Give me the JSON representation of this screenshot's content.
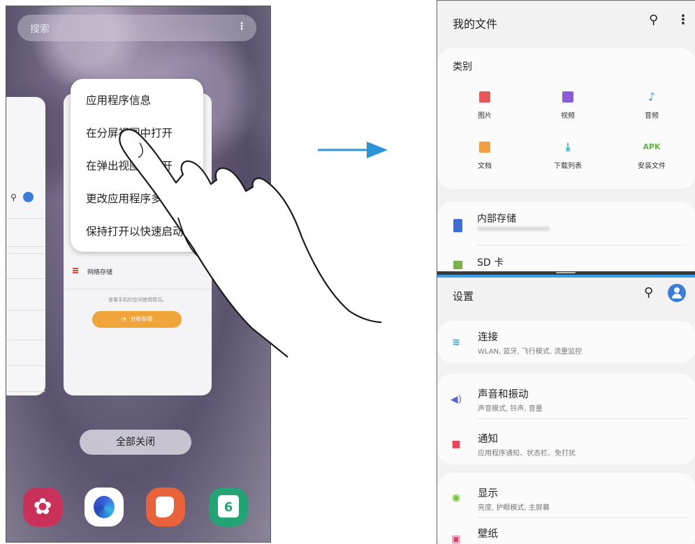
{
  "left_phone": {
    "search_placeholder": "搜索",
    "more_icon": "⋮",
    "context_menu": [
      "应用程序信息",
      "在分屏视图中打开",
      "在弹出视图中打开",
      "更改应用程序多",
      "保持打开以快速启动"
    ],
    "recent_card": {
      "network_storage": "网络存储",
      "hint": "查看手机的空间使用情况。",
      "analyze_button": "分析存储"
    },
    "close_all": "全部关闭",
    "dock_icons": [
      "gallery-icon",
      "bixby-icon",
      "samsung-notes-icon",
      "calendar-icon"
    ]
  },
  "right_phone": {
    "files": {
      "title": "我的文件",
      "category_title": "类别",
      "categories": [
        {
          "label": "图片",
          "icon": "image-icon",
          "color": "#e4575a"
        },
        {
          "label": "视频",
          "icon": "video-icon",
          "color": "#8a5cd6"
        },
        {
          "label": "音频",
          "icon": "audio-icon",
          "color": "#3d8ee0"
        },
        {
          "label": "文档",
          "icon": "document-icon",
          "color": "#f0a040"
        },
        {
          "label": "下载列表",
          "icon": "download-icon",
          "color": "#29a8c8"
        },
        {
          "label": "安装文件",
          "icon": "apk-icon",
          "color": "#62b347",
          "glyph": "APK"
        }
      ],
      "storage": [
        {
          "title": "内部存储"
        },
        {
          "title": "SD 卡"
        }
      ]
    },
    "settings": {
      "title": "设置",
      "rows": [
        {
          "title": "连接",
          "subtitle": "WLAN, 蓝牙, 飞行模式, 流量监控",
          "icon": "wifi-icon"
        },
        {
          "title": "声音和振动",
          "subtitle": "声音模式, 铃声, 音量",
          "icon": "sound-icon"
        },
        {
          "title": "通知",
          "subtitle": "应用程序通知、状态栏、免打扰",
          "icon": "notification-icon"
        },
        {
          "title": "显示",
          "subtitle": "亮度, 护眼模式, 主屏幕",
          "icon": "display-icon"
        },
        {
          "title": "壁纸",
          "subtitle": "",
          "icon": "wallpaper-icon"
        }
      ]
    }
  },
  "colors": {
    "accent_blue": "#3c7dd8",
    "analyze_orange": "#f0a53a",
    "arrow_blue": "#2f93d8"
  }
}
